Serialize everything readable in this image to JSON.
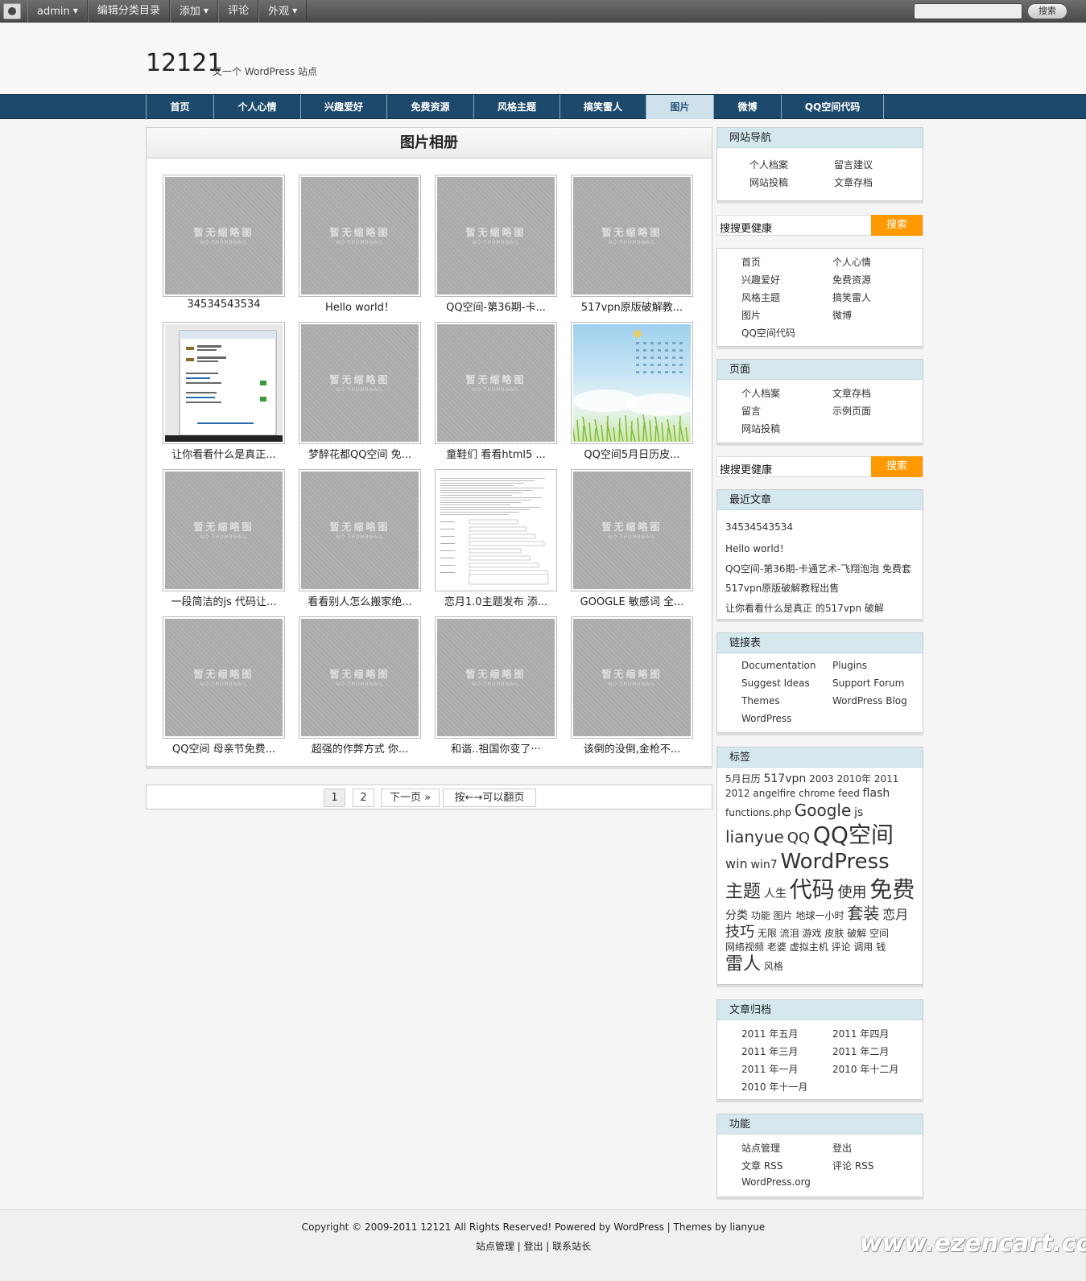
{
  "adminbar": {
    "menu": [
      {
        "label": "admin",
        "caret": true
      },
      {
        "label": "编辑分类目录",
        "caret": false
      },
      {
        "label": "添加",
        "caret": true
      },
      {
        "label": "评论",
        "caret": false
      },
      {
        "label": "外观",
        "caret": true
      }
    ],
    "search_button": "搜索"
  },
  "site": {
    "title": "12121",
    "description": "又一个 WordPress 站点"
  },
  "nav": [
    {
      "label": "首页",
      "active": false
    },
    {
      "label": "个人心情",
      "active": false
    },
    {
      "label": "兴趣爱好",
      "active": false
    },
    {
      "label": "免费资源",
      "active": false
    },
    {
      "label": "风格主题",
      "active": false
    },
    {
      "label": "搞笑雷人",
      "active": false
    },
    {
      "label": "图片",
      "active": true
    },
    {
      "label": "微博",
      "active": false
    },
    {
      "label": "QQ空间代码",
      "active": false
    }
  ],
  "gallery": {
    "title": "图片相册",
    "no_thumb_cn": "暂无缩略图",
    "no_thumb_en": "NO THUMBNAIL",
    "items": [
      {
        "caption": "34534543534",
        "type": "none"
      },
      {
        "caption": "Hello world！",
        "type": "none"
      },
      {
        "caption": "QQ空间-第36期-卡...",
        "type": "none"
      },
      {
        "caption": "517vpn原版破解教...",
        "type": "none"
      },
      {
        "caption": "让你看看什么是真正...",
        "type": "vpn"
      },
      {
        "caption": "梦醉花都QQ空间 免...",
        "type": "none"
      },
      {
        "caption": "童鞋们 看看html5 ...",
        "type": "none"
      },
      {
        "caption": "QQ空间5月日历皮...",
        "type": "sky"
      },
      {
        "caption": "一段简洁的js 代码让...",
        "type": "none"
      },
      {
        "caption": "看看别人怎么搬家绝...",
        "type": "none"
      },
      {
        "caption": "恋月1.0主题发布 添...",
        "type": "doc"
      },
      {
        "caption": "GOOGLE 敏感词 全...",
        "type": "none"
      },
      {
        "caption": "QQ空间 母亲节免费...",
        "type": "none"
      },
      {
        "caption": "超强的作弊方式 你...",
        "type": "none"
      },
      {
        "caption": "和谐..祖国你变了···",
        "type": "none"
      },
      {
        "caption": "该倒的没倒,金枪不...",
        "type": "none"
      }
    ]
  },
  "pager": {
    "pages": [
      "1",
      "2"
    ],
    "current": "1",
    "next": "下一页 »",
    "hint": "按←→可以翻页"
  },
  "sidebar": {
    "site_nav": {
      "title": "网站导航",
      "links": [
        "个人档案",
        "留言建议",
        "网站投稿",
        "文章存档"
      ]
    },
    "search": {
      "label": "搜搜更健康",
      "button": "搜索"
    },
    "categories": {
      "links": [
        "首页",
        "个人心情",
        "兴趣爱好",
        "免费资源",
        "风格主题",
        "搞笑雷人",
        "图片",
        "微博",
        "QQ空间代码"
      ]
    },
    "pages": {
      "title": "页面",
      "links": [
        "个人档案",
        "文章存档",
        "留言",
        "示例页面",
        "网站投稿"
      ]
    },
    "search2": {
      "label": "搜搜更健康",
      "button": "搜索"
    },
    "recent": {
      "title": "最近文章",
      "links": [
        "34534543534",
        "Hello world！",
        "QQ空间-第36期-卡通艺术-飞翔泡泡 免费套",
        "517vpn原版破解教程出售",
        "让你看看什么是真正 的517vpn 破解"
      ]
    },
    "blogroll": {
      "title": "链接表",
      "links": [
        "Documentation",
        "Plugins",
        "Suggest Ideas",
        "Support Forum",
        "Themes",
        "WordPress Blog",
        "WordPress"
      ]
    },
    "tags": {
      "title": "标签",
      "items": [
        {
          "t": "5月日历",
          "s": 12
        },
        {
          "t": "517vpn",
          "s": 14
        },
        {
          "t": "2003",
          "s": 12
        },
        {
          "t": "2010年",
          "s": 12
        },
        {
          "t": "2011",
          "s": 12
        },
        {
          "t": "2012",
          "s": 12
        },
        {
          "t": "angelfire",
          "s": 12
        },
        {
          "t": "chrome",
          "s": 12
        },
        {
          "t": "feed",
          "s": 12
        },
        {
          "t": "flash",
          "s": 14
        },
        {
          "t": "functions.php",
          "s": 12
        },
        {
          "t": "Google",
          "s": 20
        },
        {
          "t": "js",
          "s": 14
        },
        {
          "t": "lianyue",
          "s": 20
        },
        {
          "t": "QQ",
          "s": 18
        },
        {
          "t": "QQ空间",
          "s": 28
        },
        {
          "t": "win",
          "s": 16
        },
        {
          "t": "win7",
          "s": 14
        },
        {
          "t": "WordPress",
          "s": 26
        },
        {
          "t": "主题",
          "s": 22
        },
        {
          "t": "人生",
          "s": 14
        },
        {
          "t": "代码",
          "s": 28
        },
        {
          "t": "使用",
          "s": 18
        },
        {
          "t": "免费",
          "s": 28
        },
        {
          "t": "分类",
          "s": 14
        },
        {
          "t": "功能",
          "s": 12
        },
        {
          "t": "图片",
          "s": 12
        },
        {
          "t": "地球一小时",
          "s": 12
        },
        {
          "t": "套装",
          "s": 20
        },
        {
          "t": "恋月",
          "s": 16
        },
        {
          "t": "技巧",
          "s": 18
        },
        {
          "t": "无限",
          "s": 12
        },
        {
          "t": "流泪",
          "s": 12
        },
        {
          "t": "游戏",
          "s": 12
        },
        {
          "t": "皮肤",
          "s": 12
        },
        {
          "t": "破解",
          "s": 12
        },
        {
          "t": "空间",
          "s": 12
        },
        {
          "t": "网络视频",
          "s": 12
        },
        {
          "t": "老婆",
          "s": 12
        },
        {
          "t": "虚拟主机",
          "s": 12
        },
        {
          "t": "评论",
          "s": 12
        },
        {
          "t": "调用",
          "s": 12
        },
        {
          "t": "钱",
          "s": 12
        },
        {
          "t": "雷人",
          "s": 22
        },
        {
          "t": "风格",
          "s": 12
        }
      ]
    },
    "archives": {
      "title": "文章归档",
      "links": [
        "2011 年五月",
        "2011 年四月",
        "2011 年三月",
        "2011 年二月",
        "2011 年一月",
        "2010 年十二月",
        "2010 年十一月"
      ]
    },
    "meta": {
      "title": "功能",
      "links": [
        "站点管理",
        "登出",
        "文章 RSS",
        "评论 RSS",
        "WordPress.org"
      ]
    }
  },
  "footer": {
    "line1": "Copyright © 2009-2011 12121 All Rights Reserved! Powered by WordPress | Themes by lianyue",
    "line2": "站点管理 | 登出 | 联系站长"
  },
  "watermark": "www.ezencart.com"
}
